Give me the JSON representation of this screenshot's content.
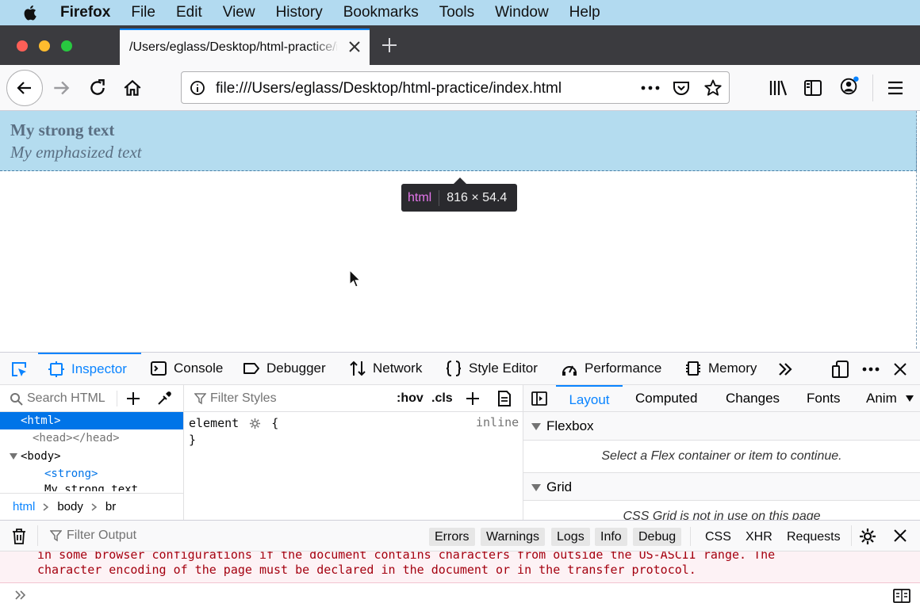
{
  "menubar": {
    "app_name": "Firefox",
    "items": [
      "File",
      "Edit",
      "View",
      "History",
      "Bookmarks",
      "Tools",
      "Window",
      "Help"
    ]
  },
  "tab": {
    "title": "/Users/eglass/Desktop/html-practice/index.html",
    "close_icon": "close-icon"
  },
  "nav": {
    "url": "file:///Users/eglass/Desktop/html-practice/index.html"
  },
  "page": {
    "strong_text": "My strong text",
    "em_text": "My emphasized text",
    "infobar_tag": "html",
    "infobar_dims": "816 × 54.4"
  },
  "devtools": {
    "tabs": [
      "Inspector",
      "Console",
      "Debugger",
      "Network",
      "Style Editor",
      "Performance",
      "Memory"
    ],
    "selected_tab": "Inspector",
    "markup": {
      "search_placeholder": "Search HTML",
      "tree": [
        {
          "text": "<html>",
          "indent": 0
        },
        {
          "text": "<head></head>",
          "indent": 1
        },
        {
          "text": "<body>",
          "indent": 0
        },
        {
          "text": "<strong>",
          "indent": 2
        },
        {
          "text": "My strong text",
          "indent": 2
        }
      ],
      "breadcrumbs": [
        "html",
        "body",
        "br"
      ]
    },
    "rules": {
      "filter_placeholder": "Filter Styles",
      "hov_label": ":hov",
      "cls_label": ".cls",
      "selector": "element",
      "open_brace": "{",
      "close_brace": "}",
      "source": "inline"
    },
    "layout": {
      "tabs": [
        "Layout",
        "Computed",
        "Changes",
        "Fonts",
        "Anim"
      ],
      "selected_tab": "Layout",
      "flexbox_title": "Flexbox",
      "flexbox_msg": "Select a Flex container or item to continue.",
      "grid_title": "Grid",
      "grid_msg": "CSS Grid is not in use on this page"
    }
  },
  "console": {
    "filter_placeholder": "Filter Output",
    "filters": [
      "Errors",
      "Warnings",
      "Logs",
      "Info",
      "Debug"
    ],
    "extra_filters": [
      "CSS",
      "XHR",
      "Requests"
    ],
    "messages": [
      "in some browser configurations if the document contains characters from outside the US-ASCII range. The",
      "character encoding of the page must be declared in the document or in the transfer protocol."
    ]
  },
  "colors": {
    "accent": "#0a84ff",
    "highlight": "#b4dcef",
    "menubar": "#b2daf0",
    "error_text": "#a4000f"
  }
}
